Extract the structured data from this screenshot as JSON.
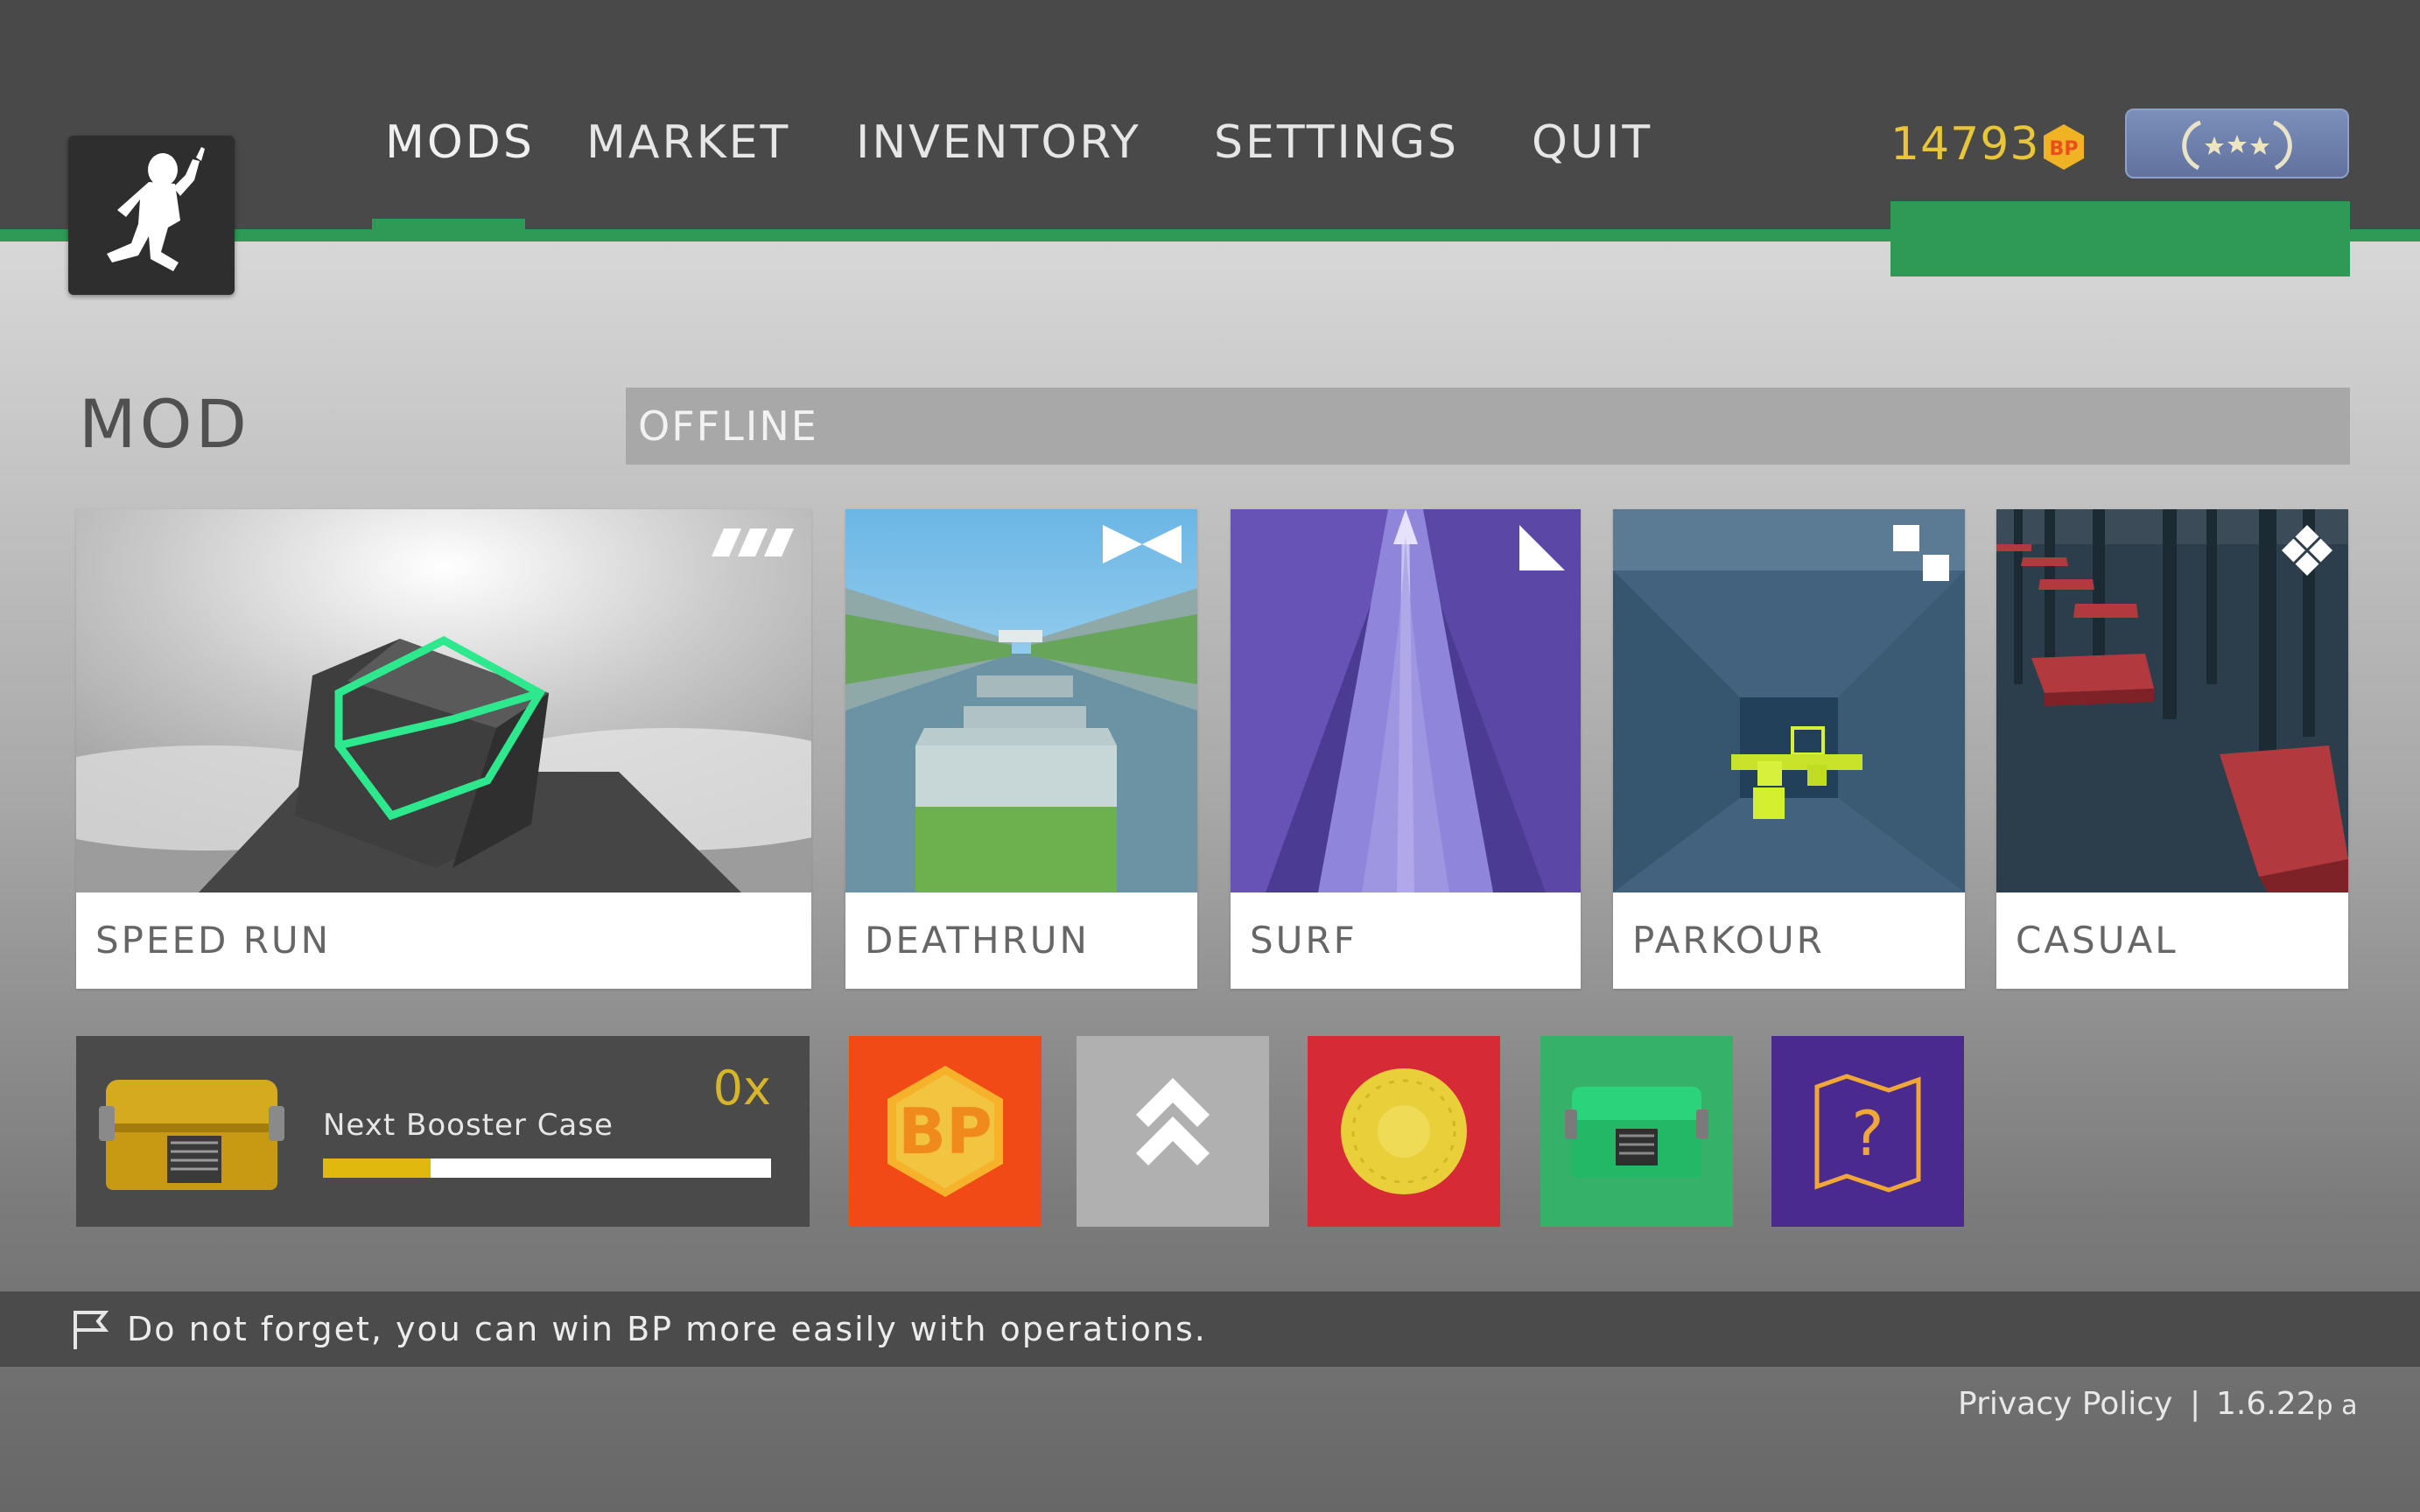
{
  "nav": {
    "items": [
      {
        "label": "MODS",
        "active": true
      },
      {
        "label": "MARKET",
        "active": false
      },
      {
        "label": "INVENTORY",
        "active": false
      },
      {
        "label": "SETTINGS",
        "active": false
      },
      {
        "label": "QUIT",
        "active": false
      }
    ]
  },
  "header": {
    "bp_amount": "14793",
    "bp_badge_text": "BP",
    "rank_icon": "rank-laurel-stars-icon"
  },
  "section": {
    "title": "MOD",
    "status": "OFFLINE"
  },
  "mods": [
    {
      "label": "SPEED RUN",
      "icon": "speed-stripes-icon"
    },
    {
      "label": "DEATHRUN",
      "icon": "bowtie-icon"
    },
    {
      "label": "SURF",
      "icon": "triangle-icon"
    },
    {
      "label": "PARKOUR",
      "icon": "offset-squares-icon"
    },
    {
      "label": "CASUAL",
      "icon": "diamond-cluster-icon"
    }
  ],
  "booster": {
    "label": "Next Booster Case",
    "count": "0x",
    "progress": 0.24
  },
  "shortcuts": [
    {
      "name": "bp-shop",
      "icon": "bp-hexagon-icon",
      "color": "#f24a16",
      "text": "BP"
    },
    {
      "name": "rank-up",
      "icon": "double-chevron-up-icon",
      "color": "#b0b0b0"
    },
    {
      "name": "coin",
      "icon": "gold-coin-icon",
      "color": "#d62a36"
    },
    {
      "name": "case",
      "icon": "green-case-icon",
      "color": "#36b16a"
    },
    {
      "name": "operations",
      "icon": "map-question-icon",
      "color": "#4a2a8e",
      "text": "?"
    }
  ],
  "tip": {
    "icon": "flag-icon",
    "text": "Do not forget, you can win BP more easily with operations."
  },
  "footer": {
    "privacy": "Privacy Policy",
    "separator": "|",
    "version": "1.6.22",
    "version_suffix": "p a"
  },
  "colors": {
    "accent_green": "#2e9a55",
    "bp_gold": "#e8c53a",
    "topbar": "#494949"
  }
}
